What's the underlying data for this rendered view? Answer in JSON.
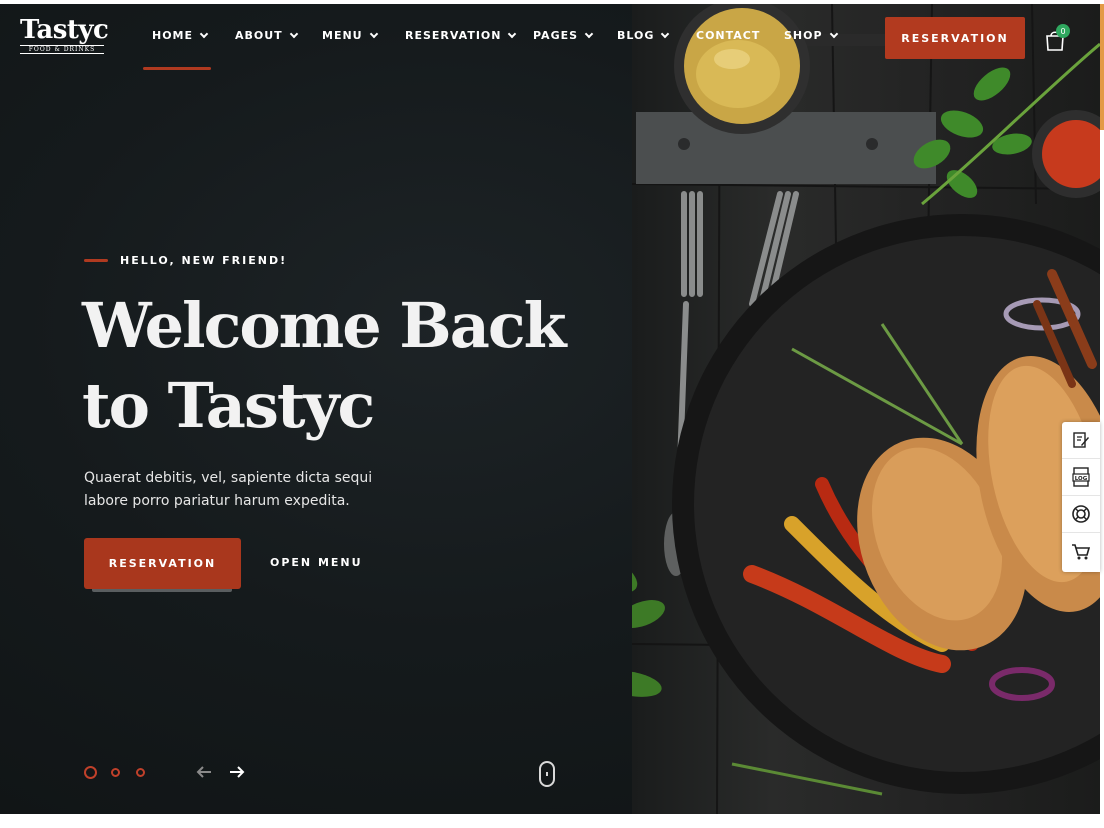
{
  "brand": {
    "name": "Tastyc",
    "tagline": "FOOD & DRINKS"
  },
  "nav": {
    "items": [
      {
        "label": "HOME",
        "has_dropdown": true,
        "active": true
      },
      {
        "label": "ABOUT",
        "has_dropdown": true
      },
      {
        "label": "MENU",
        "has_dropdown": true
      },
      {
        "label": "RESERVATION",
        "has_dropdown": true
      },
      {
        "label": "PAGES",
        "has_dropdown": true
      },
      {
        "label": "BLOG",
        "has_dropdown": true
      },
      {
        "label": "CONTACT",
        "has_dropdown": false
      },
      {
        "label": "SHOP",
        "has_dropdown": true
      }
    ],
    "cta_label": "RESERVATION",
    "cart_count": "0"
  },
  "hero": {
    "eyebrow": "HELLO, NEW FRIEND!",
    "title_line1": "Welcome Back",
    "title_line2": "to Tastyc",
    "description_line1": "Quaerat debitis, vel, sapiente dicta sequi",
    "description_line2": "labore porro pariatur harum expedita.",
    "primary_button": "RESERVATION",
    "secondary_link": "OPEN MENU"
  },
  "slider": {
    "slide_count": 3,
    "active_index": 0
  },
  "side_tools": [
    "edit-icon",
    "log-icon",
    "lifebuoy-icon",
    "cart-icon"
  ],
  "colors": {
    "accent": "#b23a1f",
    "background": "#151a1c",
    "cart_badge": "#2fa85f"
  }
}
